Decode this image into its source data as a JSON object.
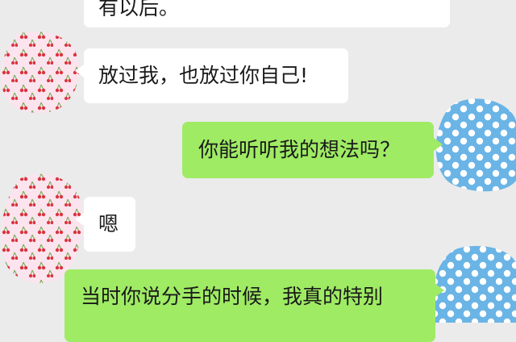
{
  "chat": {
    "messages": [
      {
        "side": "received",
        "text": "有以后。"
      },
      {
        "side": "received",
        "text": "放过我，也放过你自己!"
      },
      {
        "side": "sent",
        "text": "你能听听我的想法吗？"
      },
      {
        "side": "received",
        "text": "嗯"
      },
      {
        "side": "sent",
        "text": "当时你说分手的时候，我真的特别"
      }
    ]
  },
  "avatars": {
    "contact": {
      "icon": "cherry-pattern-avatar",
      "background": "#fbe4ee",
      "fruit": "#d9343f",
      "leaf": "#6fa84a"
    },
    "self": {
      "icon": "polka-dot-avatar",
      "background": "#6ab4e6",
      "dots": "#ffffff"
    }
  },
  "colors": {
    "chat_background": "#ebebeb",
    "received_bubble": "#ffffff",
    "sent_bubble": "#9feb64"
  }
}
